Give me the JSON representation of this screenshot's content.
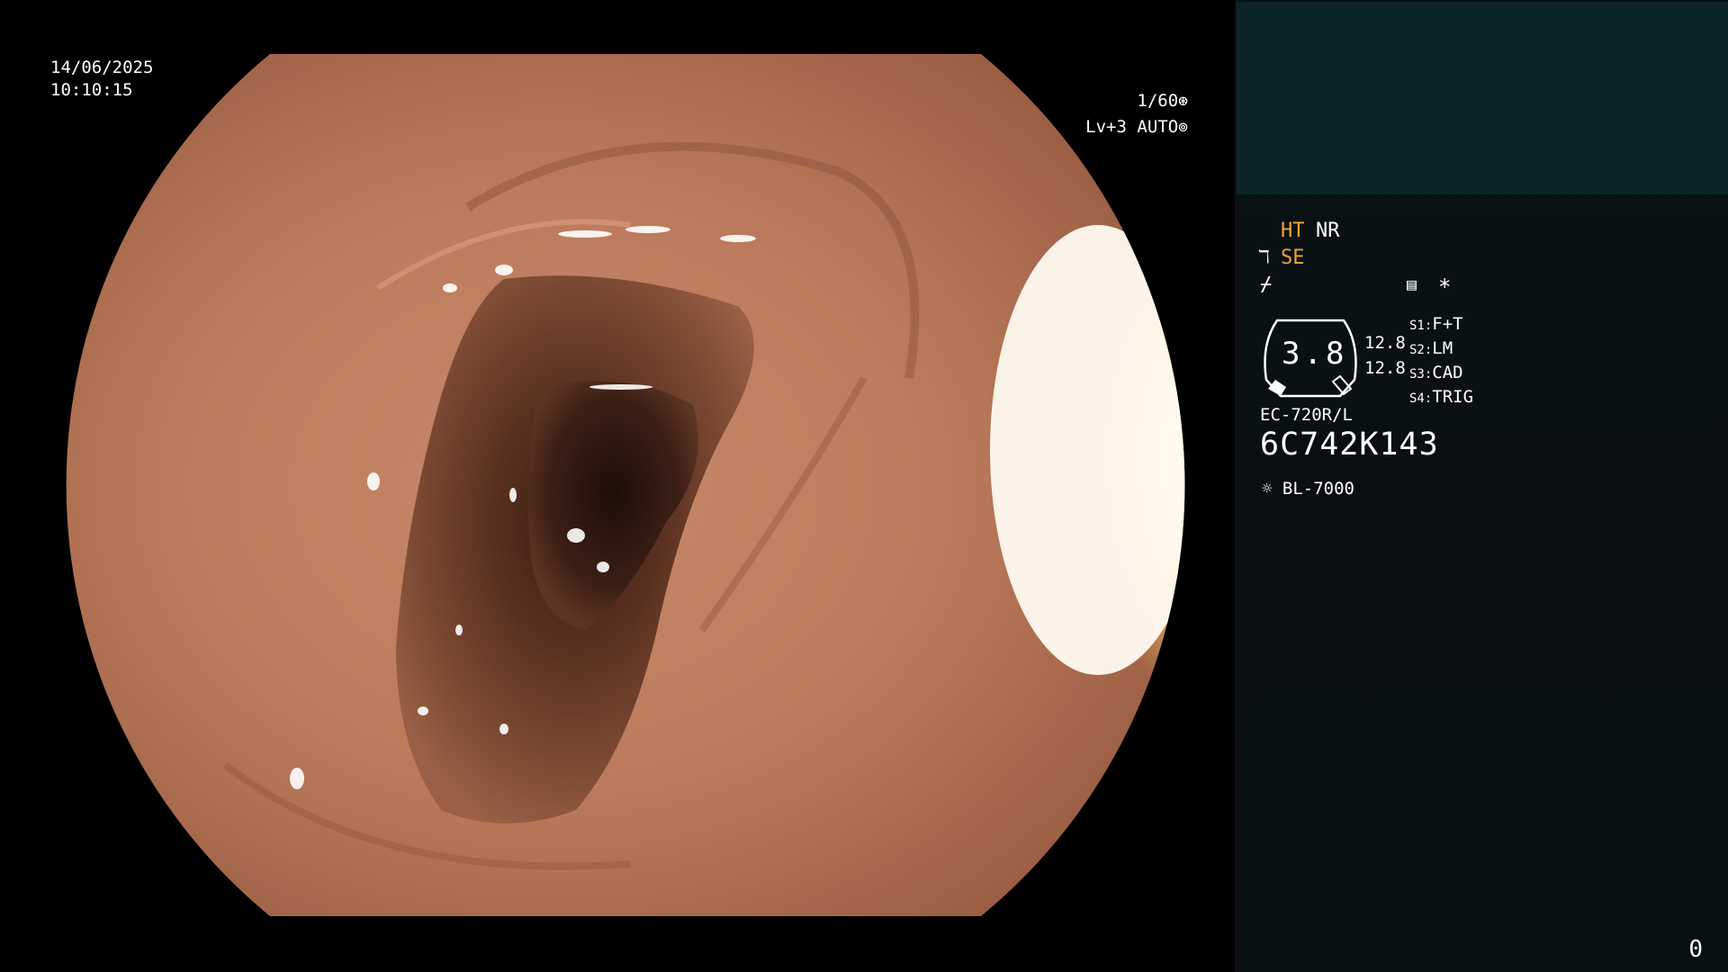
{
  "overlay": {
    "date": "14/06/2025",
    "time": "10:10:15",
    "shutter": "1/60",
    "level": "Lv+3",
    "iris": "AUTO"
  },
  "panel": {
    "ht": "HT",
    "nr": "NR",
    "se": "SE",
    "gauge_value": "3.8",
    "gauge_side_top": "12.8",
    "gauge_side_bottom": "12.8",
    "switches": [
      {
        "key": "S1:",
        "value": "F+T"
      },
      {
        "key": "S2:",
        "value": "LM"
      },
      {
        "key": "S3:",
        "value": "CAD"
      },
      {
        "key": "S4:",
        "value": "TRIG"
      }
    ],
    "model": "EC-720R/L",
    "serial": "6C742K143",
    "light_source": "BL-7000",
    "star": "*"
  },
  "page_number": "0",
  "colors": {
    "accent_orange": "#f2a23a",
    "panel_top": "#0b2526",
    "panel_bg": "#0a1213"
  }
}
